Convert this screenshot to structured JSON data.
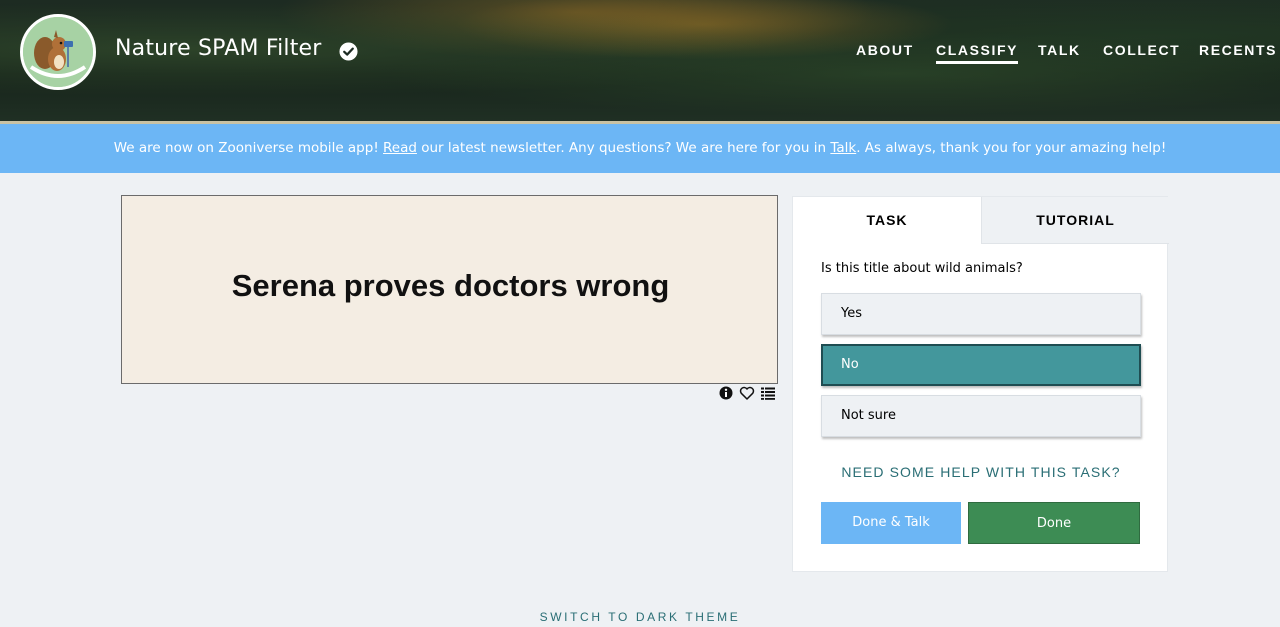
{
  "header": {
    "site_title": "Nature SPAM Filter",
    "logo_icon": "squirrel-logo-icon",
    "verified_icon": "check-circle-icon",
    "nav": [
      {
        "label": "ABOUT",
        "active": false
      },
      {
        "label": "CLASSIFY",
        "active": true
      },
      {
        "label": "TALK",
        "active": false
      },
      {
        "label": "COLLECT",
        "active": false
      },
      {
        "label": "RECENTS",
        "active": false
      }
    ]
  },
  "banner": {
    "part1": "We are now on Zooniverse mobile app! ",
    "read_link": "Read",
    "part2": " our latest newsletter. Any questions? We are here for you in ",
    "talk_link": "Talk",
    "part3": ". As always, thank you for your amazing help!",
    "color": "#6cb6f5"
  },
  "subject": {
    "text": "Serena proves doctors wrong",
    "icons": [
      "info-icon",
      "heart-icon",
      "list-icon"
    ]
  },
  "task_panel": {
    "tabs": {
      "task": "TASK",
      "tutorial": "TUTORIAL"
    },
    "question": "Is this title about wild animals?",
    "answers": [
      {
        "label": "Yes",
        "selected": false
      },
      {
        "label": "No",
        "selected": true
      },
      {
        "label": "Not sure",
        "selected": false
      }
    ],
    "help_label": "NEED SOME HELP WITH THIS TASK?",
    "done_talk_label": "Done & Talk",
    "done_label": "Done",
    "colors": {
      "selected": "#43979c",
      "done": "#3d8c54",
      "done_talk": "#6cb6f5"
    }
  },
  "footer": {
    "dark_theme_label": "SWITCH TO DARK THEME"
  }
}
